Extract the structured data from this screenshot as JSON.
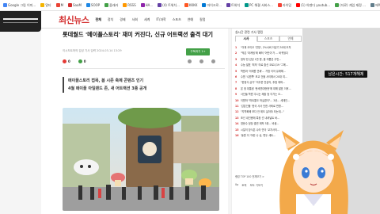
{
  "bookmarks": [
    {
      "label": "Google 그림 이미...",
      "color": "#4285f4"
    },
    {
      "label": "알티",
      "color": "#f4b400"
    },
    {
      "label": "M",
      "color": "#ea4335"
    },
    {
      "label": "SaaM",
      "color": "#d32f2f"
    },
    {
      "label": "SOOP",
      "color": "#1e88e5"
    },
    {
      "label": "플래카",
      "color": "#43a047"
    },
    {
      "label": "RSSS",
      "color": "#ff9800"
    },
    {
      "label": "HA...",
      "color": "#8e24aa"
    },
    {
      "label": "(4) 트위치...",
      "color": "#6441a5"
    },
    {
      "label": "KKKK",
      "color": "#ff5722"
    },
    {
      "label": "마이크로...",
      "color": "#0078d4"
    },
    {
      "label": "트위치",
      "color": "#6441a5"
    },
    {
      "label": "PC 해결 서비스...",
      "color": "#009688"
    },
    {
      "label": "라이덤",
      "color": "#f44336"
    },
    {
      "label": "(1) 아젠다 youtub...",
      "color": "#ff0000"
    },
    {
      "label": "(자료) 게임 재정 ...",
      "color": "#43a047"
    },
    {
      "label": "에펙트 토 모빌 ...",
      "color": "#607d8b"
    }
  ],
  "header": {
    "logo": "최신뉴스",
    "nav": [
      "전체",
      "정치",
      "경제",
      "사회",
      "세계",
      "IT/과학",
      "스포츠",
      "연예",
      "칼럼"
    ]
  },
  "article": {
    "headline": "롯데월드 '메이플스토리' 재미 커진다, 신규 어트랙션 출격 대기",
    "meta": "이시도트하의 김성   기사 입력 2024-03-14 13:29",
    "subscribe_label": "구독하기 1+",
    "reactions": {
      "likes": "0",
      "comments": "0"
    },
    "summary": [
      "메이플스토리 접목, 봄 시즌 축제 콘텐츠 인기",
      "4월 메이플 아일랜드 존, 새 어트랙션 3종 공개"
    ]
  },
  "sidebar": {
    "title": "실시간 관련 기사 랭킹",
    "tabs": [
      "시사",
      "스포츠",
      "연예"
    ],
    "active_tab": "시사",
    "ranks": [
      {
        "num": "1",
        "text": "\"이재 오이오 '연방', 2%서버 이성기 30대 도처"
      },
      {
        "num": "2",
        "text": "\"박은 '마케팅'에 빠져 '어린이'가 ... 바뀌었다"
      },
      {
        "num": "3",
        "text": "정부 한 감성 1만 명, 올 여름은 주민..."
      },
      {
        "num": "4",
        "text": "수능 발표 '최저' 의료 출신 코로나19 '그에..."
      },
      {
        "num": "5",
        "text": "학원과 '이태원 연쇄'... 가방 이어 유래해..."
      },
      {
        "num": "6",
        "text": "수원 '수원쪽' 모교 건물 사이에서 20대 여..."
      },
      {
        "num": "7",
        "text": "\"한정식 삼가\" 허우준 전공의, 추첨 재파..."
      },
      {
        "num": "8",
        "text": "온 정 대통령 '문세연대현현'에 대해 발표 이후..."
      },
      {
        "num": "9",
        "text": "사인들 학원 주니는 제출 등 이가는 오..."
      },
      {
        "num": "10",
        "text": "이원하 \"마트통도 하실경이\"... 3공... 세계인..."
      },
      {
        "num": "11",
        "text": "'감온인물 '한국 사사 단한 사퇴로 판명..."
      },
      {
        "num": "12",
        "text": "\"지역화폐 보다 안 제도 살아야 되는데...\""
      },
      {
        "num": "13",
        "text": "조선 내인증에 특정 선 내셔널트 바..."
      },
      {
        "num": "14",
        "text": "영문수 정당 출연 제작 3위... 비생..."
      },
      {
        "num": "15",
        "text": "시일이 장식은 나라 연극 '교차사의..."
      },
      {
        "num": "16",
        "text": "'동원 이 '어린 나 상, 변두 세트..."
      }
    ],
    "more_label": "랭킹 TOP 100 전체보기 >",
    "bottom": [
      "0p",
      "토픽",
      "보도 기보기"
    ]
  },
  "stream": {
    "viewer_label": "남은시간: 517개해제"
  }
}
